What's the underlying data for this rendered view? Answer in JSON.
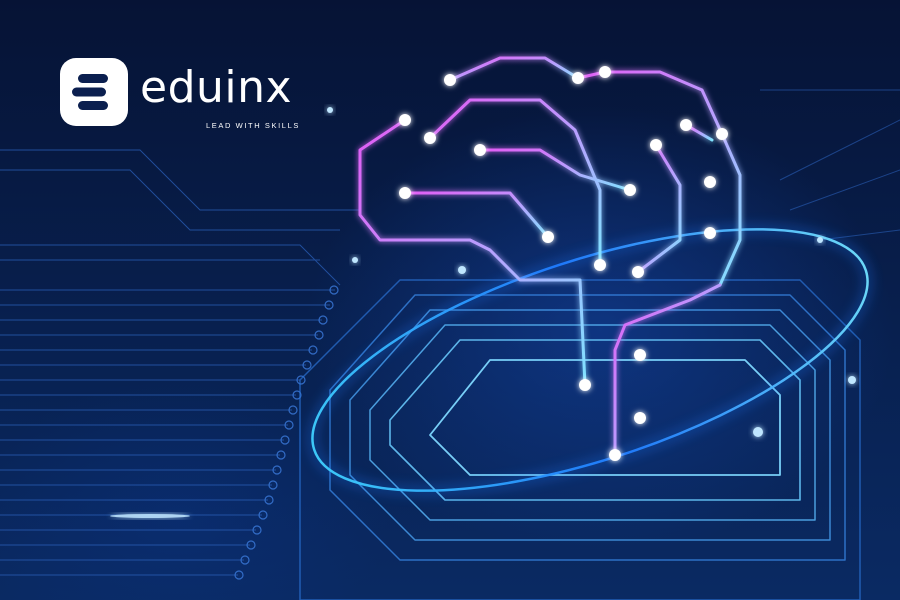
{
  "brand": {
    "name": "eduinx",
    "tagline": "LEAD WITH SKILLS"
  },
  "icons": {
    "logo": "eduinx-logo-icon",
    "illustration": "circuit-brain-icon"
  },
  "colors": {
    "background": "#06163d",
    "neon_pink": "#e25cf5",
    "neon_cyan": "#7fe3ff",
    "accent_blue": "#1f7bff"
  }
}
